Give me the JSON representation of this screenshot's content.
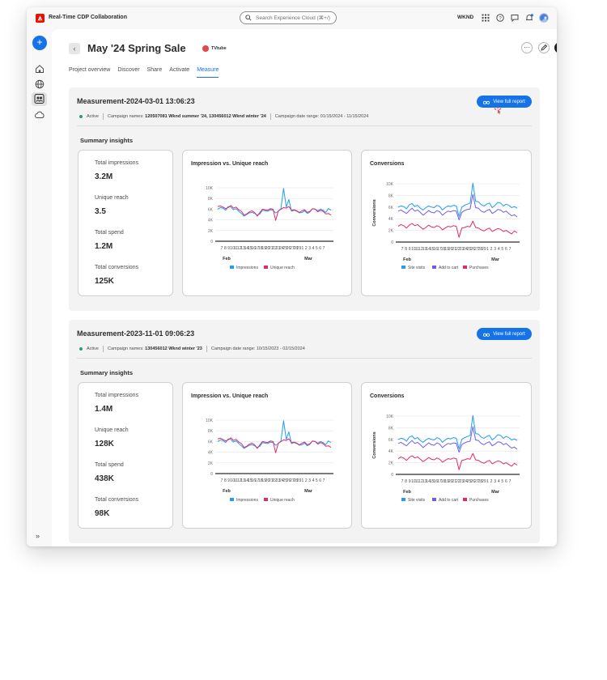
{
  "app": {
    "title": "Real-Time CDP Collaboration",
    "search_placeholder": "Search Experience Cloud (⌘+/)",
    "org": "WKND"
  },
  "page": {
    "title": "May '24 Spring Sale",
    "brand": "TVtube",
    "tabs": [
      "Project overview",
      "Discover",
      "Share",
      "Activate",
      "Measure"
    ],
    "active_tab": "Measure"
  },
  "colors": {
    "accent": "#1473e6",
    "impressions": "#1f9ef2",
    "unique_reach": "#e5276c",
    "site_visits": "#1f9ef2",
    "add_to_cart": "#6e5bf0",
    "purchases": "#e5276c",
    "active": "#2d9d78"
  },
  "labels": {
    "view_report": "View full report",
    "summary_insights": "Summary insights",
    "status": "Active",
    "campaign_names_label": "Campaign names:",
    "date_range_label": "Campaign date range:",
    "kpi_labels": [
      "Total impressions",
      "Unique reach",
      "Total spend",
      "Total conversions"
    ]
  },
  "measurements": [
    {
      "title": "Measurement-2024-03-01 13:06:23",
      "campaign_names": "120507081 Wknd summer '24, 130456012 Wknd winter '24",
      "date_range": "01/15/2024 - 11/15/2024",
      "kpis": [
        "3.2M",
        "3.5",
        "1.2M",
        "125K"
      ]
    },
    {
      "title": "Measurement-2023-11-01 09:06:23",
      "campaign_names": "130456012 Wknd winter '23",
      "date_range": "10/15/2023 - 02/15/2024",
      "kpis": [
        "1.4M",
        "128K",
        "438K",
        "98K"
      ]
    }
  ],
  "chart_data": [
    {
      "type": "line",
      "title": "Impression vs. Unique reach",
      "ylim": [
        0,
        10000
      ],
      "y_ticks": [
        "0",
        "2K",
        "4K",
        "6K",
        "8K",
        "10K"
      ],
      "x_ticks": [
        "7",
        "8",
        "9",
        "10",
        "11",
        "12",
        "13",
        "14",
        "15",
        "16",
        "17",
        "18",
        "19",
        "20",
        "21",
        "22",
        "23",
        "24",
        "25",
        "26",
        "27",
        "28",
        "29",
        "1",
        "2",
        "3",
        "4",
        "5",
        "6",
        "7"
      ],
      "x_month_labels": [
        "Feb",
        "Mar"
      ],
      "series": [
        {
          "name": "Impressions",
          "values": [
            6000,
            6300,
            6200,
            5800,
            6500,
            6400,
            5900,
            6100,
            5600,
            5200,
            4700,
            5000,
            5300,
            5400,
            5200,
            4900,
            5100,
            5800,
            5700,
            5600,
            5900,
            5800,
            5300,
            5600,
            6100,
            9900,
            6400,
            7800,
            5600,
            5800,
            5600,
            5300,
            5400,
            5700,
            5200,
            5500,
            6100,
            6000,
            5700,
            6000,
            5800,
            5400,
            6100,
            5800
          ]
        },
        {
          "name": "Unique reach",
          "values": [
            6500,
            6600,
            6400,
            6100,
            6300,
            6700,
            6200,
            6400,
            5900,
            5600,
            4900,
            5100,
            5500,
            5700,
            5400,
            4700,
            5400,
            6000,
            5900,
            5800,
            6100,
            6000,
            3900,
            5700,
            6000,
            6300,
            6200,
            6500,
            5800,
            5900,
            5700,
            5400,
            5700,
            5900,
            5400,
            5600,
            6100,
            6000,
            5500,
            5800,
            5600,
            5100,
            5200,
            4900
          ]
        }
      ]
    },
    {
      "type": "line",
      "title": "Conversions",
      "ylabel": "Conversions",
      "ylim": [
        0,
        10000
      ],
      "y_ticks": [
        "0",
        "2K",
        "4K",
        "6K",
        "8K",
        "10K"
      ],
      "x_ticks": [
        "7",
        "8",
        "9",
        "10",
        "11",
        "12",
        "13",
        "14",
        "15",
        "16",
        "17",
        "18",
        "19",
        "20",
        "21",
        "22",
        "23",
        "24",
        "25",
        "26",
        "27",
        "28",
        "29",
        "1",
        "2",
        "3",
        "4",
        "5",
        "6",
        "7"
      ],
      "x_month_labels": [
        "Feb",
        "Mar"
      ],
      "series": [
        {
          "name": "Site visits",
          "values": [
            6000,
            6200,
            6100,
            5700,
            6400,
            6600,
            6100,
            6300,
            5800,
            5500,
            5900,
            6200,
            6000,
            5900,
            6300,
            6100,
            5500,
            5900,
            6200,
            6100,
            6300,
            6200,
            4400,
            6000,
            6300,
            6500,
            6700,
            10100,
            7000,
            6900,
            6400,
            6200,
            6500,
            6700,
            5900,
            6300,
            6800,
            6700,
            6200,
            6500,
            6300,
            5900,
            6100,
            5800
          ]
        },
        {
          "name": "Add to cart",
          "values": [
            5300,
            5500,
            5200,
            4900,
            5400,
            5800,
            5300,
            5500,
            5100,
            4600,
            5000,
            5400,
            5100,
            5000,
            5400,
            5200,
            4600,
            5000,
            5300,
            5200,
            5400,
            5300,
            3800,
            5100,
            5400,
            5600,
            5700,
            8200,
            5900,
            5800,
            5300,
            5100,
            5400,
            5600,
            4900,
            5200,
            5600,
            5500,
            5100,
            5300,
            4900,
            4500,
            4700,
            4300
          ]
        },
        {
          "name": "Purchases",
          "values": [
            2700,
            3000,
            2800,
            2400,
            2900,
            3200,
            2800,
            3000,
            2600,
            2200,
            2500,
            2900,
            2600,
            2500,
            2800,
            2600,
            2100,
            2400,
            2700,
            2600,
            2800,
            2700,
            800,
            2400,
            2500,
            2700,
            2600,
            3600,
            2500,
            2400,
            2100,
            1900,
            2200,
            2400,
            1800,
            2100,
            2300,
            2200,
            1800,
            2000,
            1700,
            1400,
            1900,
            1600
          ]
        }
      ]
    }
  ]
}
